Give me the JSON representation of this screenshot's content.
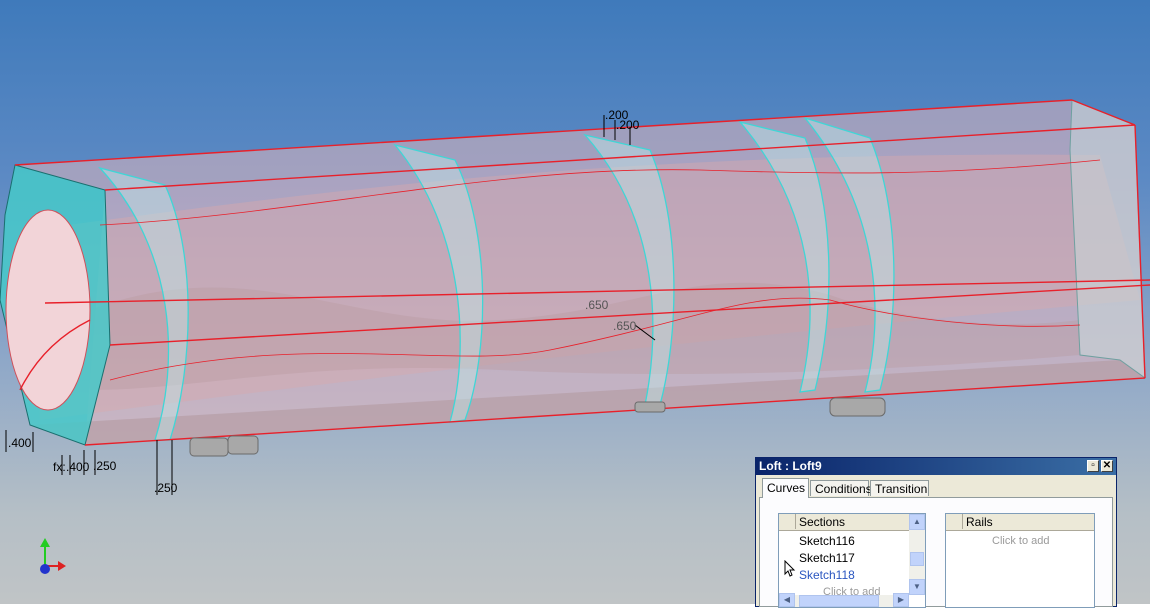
{
  "viewport": {
    "background_top": "#3f7abb",
    "background_bottom": "#c0c4c6",
    "model_edge_color": "#e8202a",
    "section_color": "#3fd6d6",
    "dimensions": {
      "d1": ".200",
      "d2": ".200",
      "d3": ".650",
      "d4": ".650",
      "d5": ".400",
      "d6": "fx:",
      "d7": ".400",
      "d8": ".250",
      "d9": ".250"
    },
    "triad_icon": "coordinate-triad-icon"
  },
  "dialog": {
    "title": "Loft : Loft9",
    "restore_icon": "restore-icon",
    "close_icon": "close-icon",
    "tabs": [
      {
        "label": "Curves"
      },
      {
        "label": "Conditions"
      },
      {
        "label": "Transition"
      }
    ],
    "sections": {
      "header": "Sections",
      "items": [
        "Sketch116",
        "Sketch117",
        "Sketch118"
      ],
      "add_hint": "Click to add"
    },
    "rails": {
      "header": "Rails",
      "add_hint": "Click to add"
    }
  }
}
